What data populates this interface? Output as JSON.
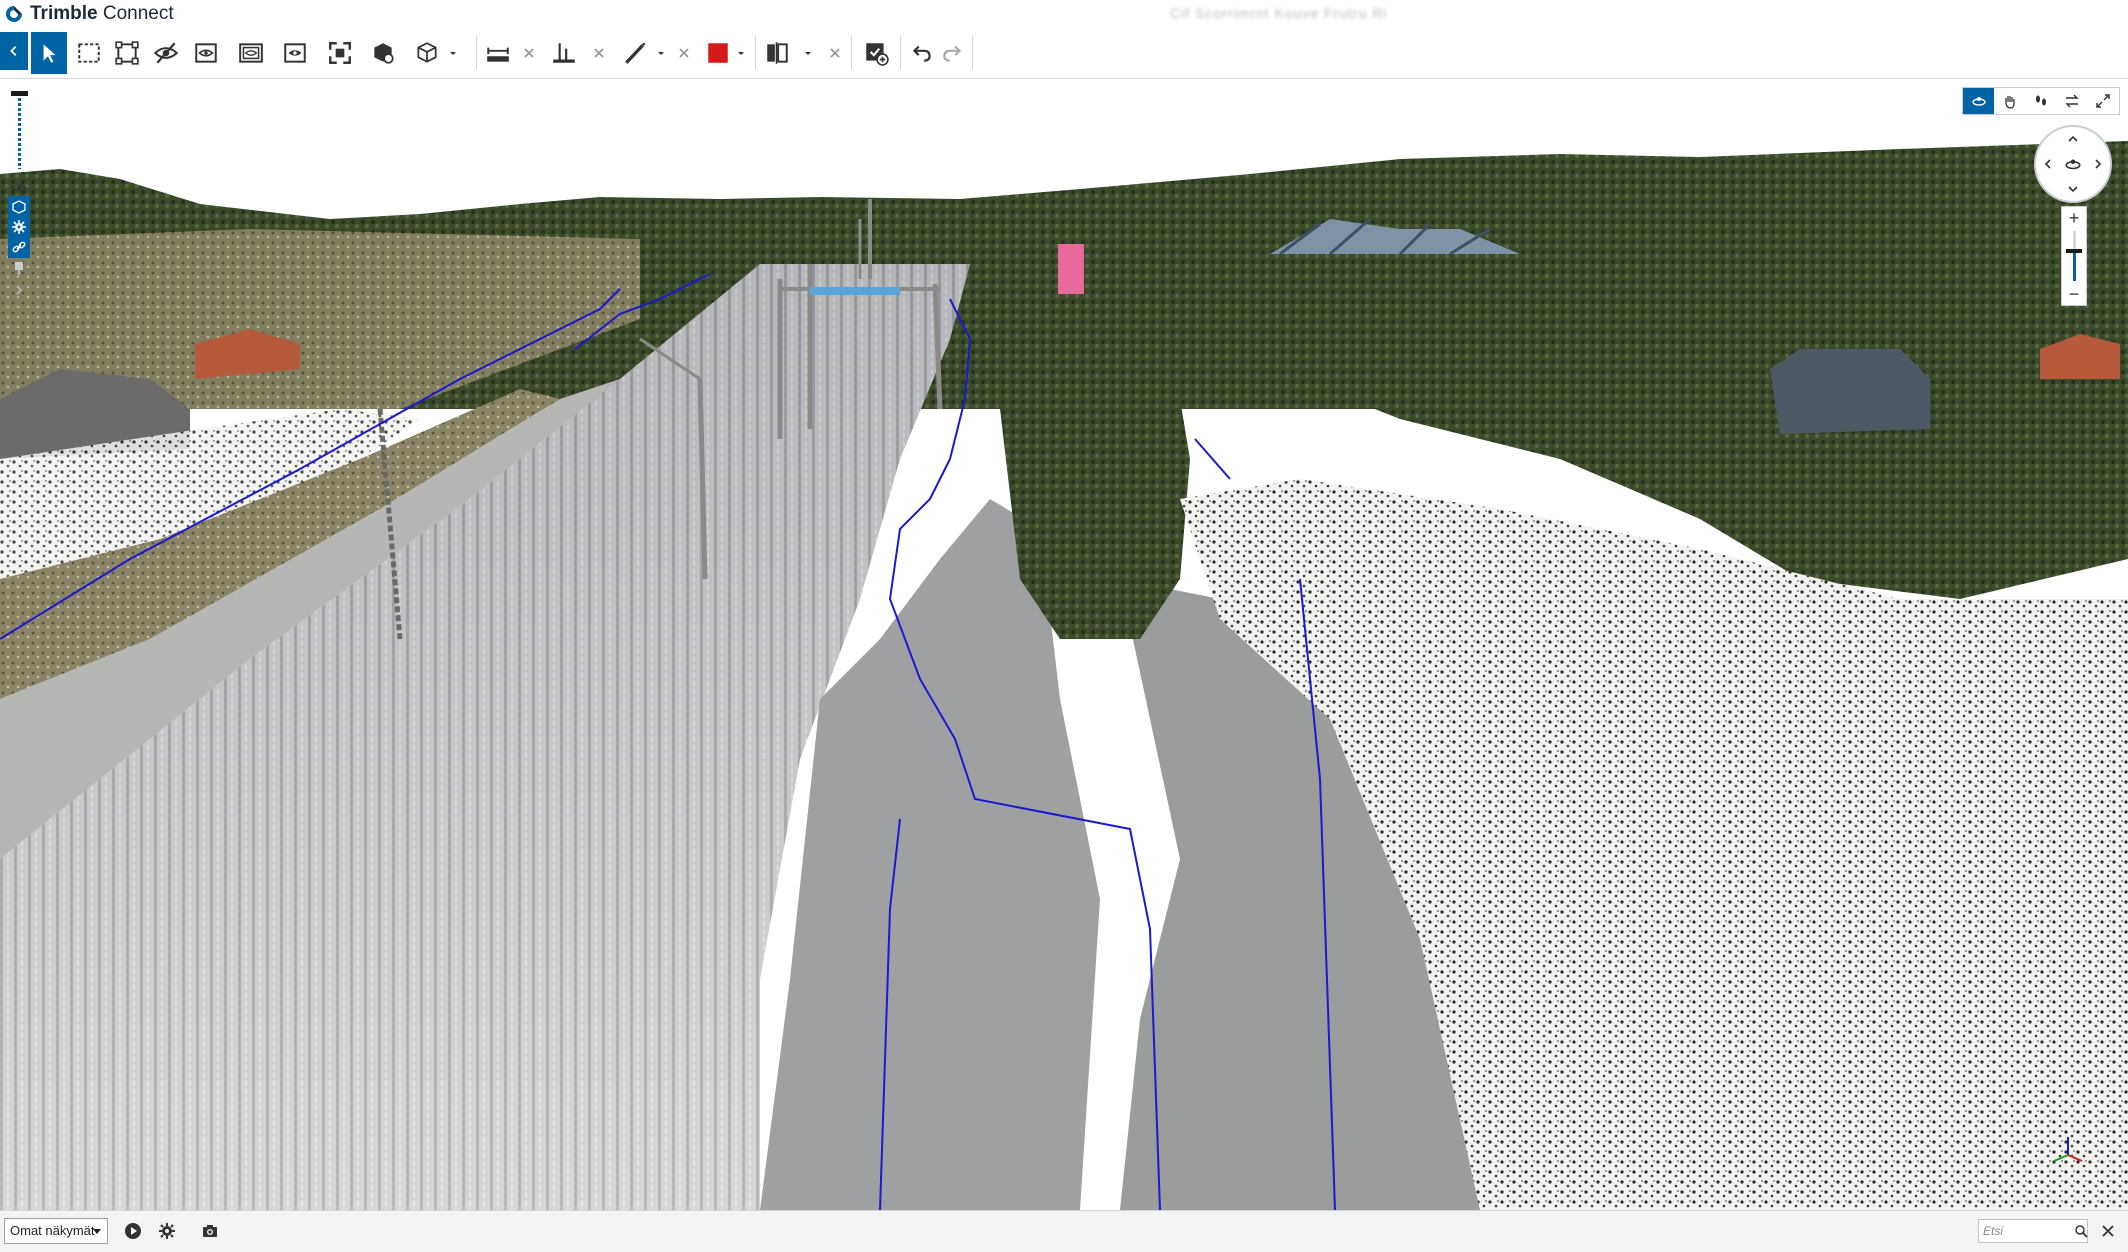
{
  "app": {
    "brand_bold": "Trimble",
    "brand_rest": " Connect",
    "doc_title": "Cif Scorrimrnt Kouve Frutru Ri",
    "accent": "#0063a3",
    "line_color": "#1a1ad0"
  },
  "toolbar": {
    "icons": [
      "back-icon",
      "select-icon",
      "box-select-icon",
      "fit-selection-icon",
      "hide-icon",
      "isolate-icon",
      "show-all-icon",
      "view-mode-icon",
      "fit-all-icon",
      "object-icon",
      "cube-view-icon",
      "measure-icon",
      "measure-clear-icon",
      "measure-point-icon",
      "measure-point-clear-icon",
      "markup-line-icon",
      "markup-clear-icon",
      "color-picker-icon",
      "section-icon",
      "section-clear-icon",
      "checklist-icon",
      "undo-icon",
      "redo-icon"
    ],
    "markup_color": "#d41a1a"
  },
  "bottom": {
    "views_label": "Omat näkymät",
    "search_placeholder": "Etsi"
  },
  "zoom": {
    "level": 0.6
  }
}
